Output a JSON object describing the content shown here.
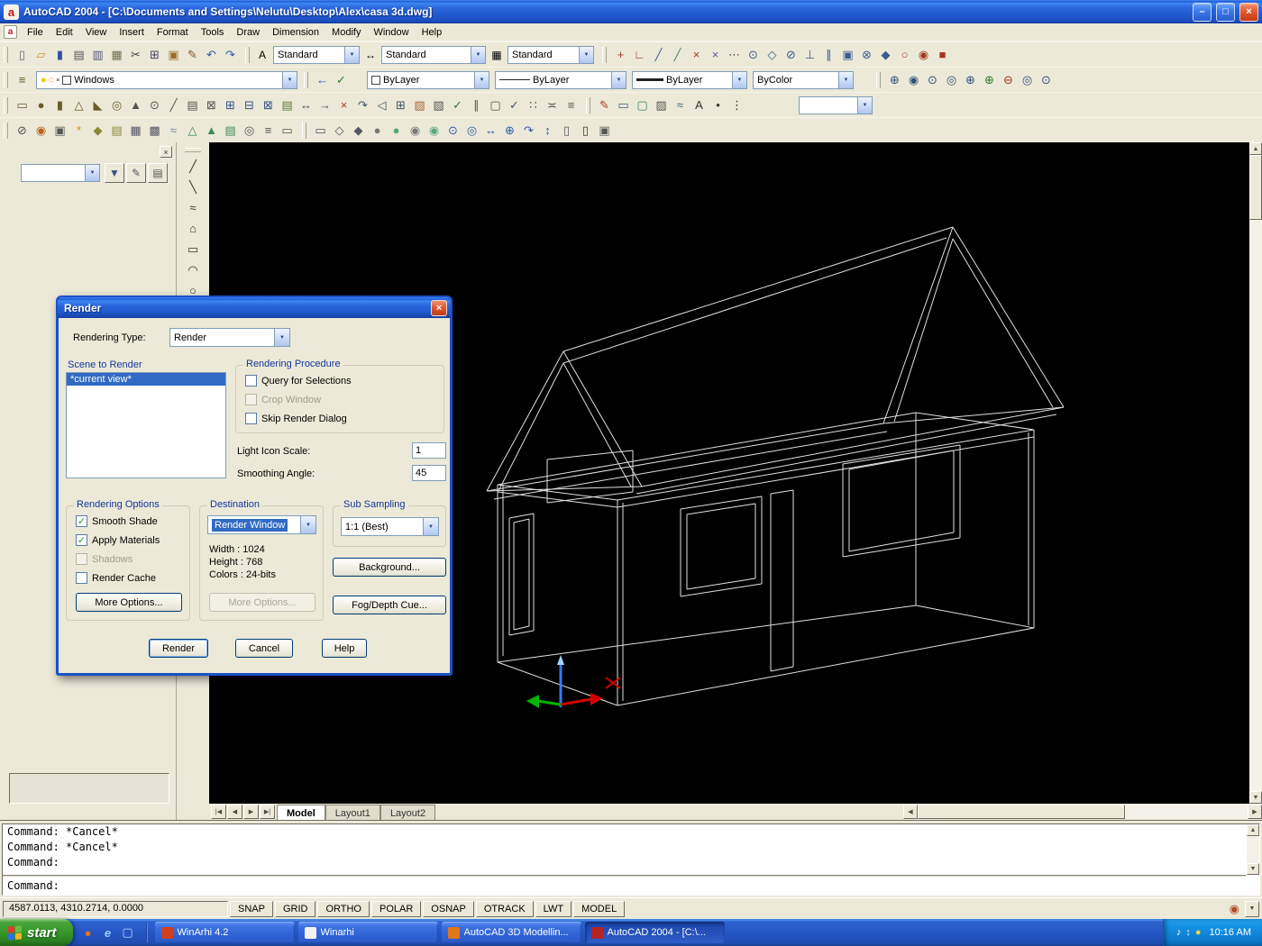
{
  "theme": {
    "face": "#ece9d8",
    "canvas": "#000000",
    "selection": "#316ac5",
    "caption": "#15359c",
    "wire": "#e0e0e0",
    "tray": "#1591e2",
    "start": "#379a2b",
    "task-a": "#5f93f2",
    "task-b": "#2c5ac4"
  },
  "glyphs": {
    "check": "✓",
    "up": "▲",
    "down": "▼",
    "left": "◀",
    "right": "▶",
    "min": "–",
    "restore": "□",
    "close": "×",
    "combo": "▼",
    "a": "a"
  },
  "titlebar": {
    "title": "AutoCAD 2004 - [C:\\Documents and Settings\\Nelutu\\Desktop\\Alex\\casa 3d.dwg]"
  },
  "menu": {
    "items": [
      {
        "n": "menu-file",
        "label": "File"
      },
      {
        "n": "menu-edit",
        "label": "Edit"
      },
      {
        "n": "menu-view",
        "label": "View"
      },
      {
        "n": "menu-insert",
        "label": "Insert"
      },
      {
        "n": "menu-format",
        "label": "Format"
      },
      {
        "n": "menu-tools",
        "label": "Tools"
      },
      {
        "n": "menu-draw",
        "label": "Draw"
      },
      {
        "n": "menu-dimension",
        "label": "Dimension"
      },
      {
        "n": "menu-modify",
        "label": "Modify"
      },
      {
        "n": "menu-window",
        "label": "Window"
      },
      {
        "n": "menu-help",
        "label": "Help"
      }
    ]
  },
  "row1": {
    "left_icons": [
      {
        "n": "new-file-icon",
        "g": "▯",
        "s": "color:#667"
      },
      {
        "n": "open-file-icon",
        "g": "▱",
        "s": "color:#c9972b"
      },
      {
        "n": "save-icon",
        "g": "▮",
        "s": "color:#34519e"
      },
      {
        "n": "plot-icon",
        "g": "▤",
        "s": "color:#555"
      },
      {
        "n": "plot-preview-icon",
        "g": "▥",
        "s": "color:#557"
      },
      {
        "n": "publish-icon",
        "g": "▦",
        "s": "color:#746c4f"
      },
      {
        "n": "cut-icon",
        "g": "✂",
        "s": "color:#444"
      },
      {
        "n": "copy-icon",
        "g": "⊞",
        "s": "color:#446"
      },
      {
        "n": "paste-icon",
        "g": "▣",
        "s": "color:#96702d"
      },
      {
        "n": "match-properties-icon",
        "g": "✎",
        "s": "color:#7c5220"
      },
      {
        "n": "undo-icon",
        "g": "↶",
        "s": "color:#2f58b0"
      },
      {
        "n": "redo-icon",
        "g": "↷",
        "s": "color:#2f58b0"
      }
    ],
    "style_icons": [
      {
        "g": "A",
        "s": "color:#334a80"
      },
      {
        "g": "↔",
        "s": "color:#334a80"
      },
      {
        "g": "▦",
        "s": "color:#334a80"
      }
    ],
    "text_style": "Standard",
    "dim_style": "Standard",
    "table_style": "Standard",
    "right_icons": [
      {
        "n": "temporary-track-point-icon",
        "g": "+",
        "s": "color:#a33c1f"
      },
      {
        "n": "snap-from-icon",
        "g": "∟",
        "s": "color:#a33c1f"
      },
      {
        "n": "snap-to-endpoint-icon",
        "g": "╱",
        "s": "color:#3b5d8c"
      },
      {
        "n": "snap-to-midpoint-icon",
        "g": "╱",
        "s": "color:#3b8c5d"
      },
      {
        "n": "snap-to-intersection-icon",
        "g": "×",
        "s": "color:#a33c1f"
      },
      {
        "n": "snap-to-apparent-intersection-icon",
        "g": "×",
        "s": "color:#6c4fa0"
      },
      {
        "n": "snap-to-extension-icon",
        "g": "⋯",
        "s": "color:#555"
      },
      {
        "n": "snap-to-center-icon",
        "g": "⊙",
        "s": "color:#3b5d8c"
      },
      {
        "n": "snap-to-quadrant-icon",
        "g": "◇",
        "s": "color:#3b5d8c"
      },
      {
        "n": "snap-to-tangent-icon",
        "g": "⊘",
        "s": "color:#3b5d8c"
      },
      {
        "n": "snap-to-perpendicular-icon",
        "g": "⊥",
        "s": "color:#3b5d8c"
      },
      {
        "n": "snap-to-parallel-icon",
        "g": "∥",
        "s": "color:#3b5d8c"
      },
      {
        "n": "snap-to-insert-icon",
        "g": "▣",
        "s": "color:#3b5d8c"
      },
      {
        "n": "snap-to-node-icon",
        "g": "⊗",
        "s": "color:#3b5d8c"
      },
      {
        "n": "snap-to-nearest-icon",
        "g": "◆",
        "s": "color:#3b5d8c"
      },
      {
        "n": "snap-to-none-icon",
        "g": "○",
        "s": "color:#a33c1f"
      },
      {
        "n": "osnap-settings-icon",
        "g": "◉",
        "s": "color:#a33c1f"
      },
      {
        "n": "dynamic-ucs-icon",
        "g": "■",
        "s": "color:#b03020"
      }
    ]
  },
  "row2": {
    "left_icons": [
      {
        "n": "layer-properties-manager-icon",
        "g": "≡",
        "s": "color:#6b5b2a"
      }
    ],
    "layer_state_icons": [
      {
        "n": "layer-on-icon",
        "g": "●",
        "s": "color:#f2c50a"
      },
      {
        "n": "layer-freeze-icon",
        "g": "○",
        "s": "color:#e8a020"
      },
      {
        "n": "layer-lock-icon",
        "g": "▪",
        "s": "color:#8a8a7a"
      }
    ],
    "layer_value": "Windows",
    "mid_icons": [
      {
        "n": "layer-previous-icon",
        "g": "←",
        "s": "color:#2f58b0"
      },
      {
        "n": "make-objects-layer-current-icon",
        "g": "✓",
        "s": "color:#2f7a2f"
      }
    ],
    "color_value": "ByLayer",
    "linetype_value": "ByLayer",
    "lineweight_value": "ByLayer",
    "plotstyle_value": "ByColor",
    "zoom_icons": [
      {
        "n": "zoom-window-icon",
        "g": "⊕",
        "s": "color:#33507a"
      },
      {
        "n": "zoom-dynamic-icon",
        "g": "◉",
        "s": "color:#33507a"
      },
      {
        "n": "zoom-scale-icon",
        "g": "⊙",
        "s": "color:#33507a"
      },
      {
        "n": "zoom-center-icon",
        "g": "◎",
        "s": "color:#33507a"
      },
      {
        "n": "zoom-object-icon",
        "g": "⊕",
        "s": "color:#33507a"
      },
      {
        "n": "zoom-in-icon",
        "g": "⊕",
        "s": "color:#2f7a2f"
      },
      {
        "n": "zoom-out-icon",
        "g": "⊖",
        "s": "color:#a33c1f"
      },
      {
        "n": "zoom-all-icon",
        "g": "◎",
        "s": "color:#33507a"
      },
      {
        "n": "zoom-extents-icon",
        "g": "⊙",
        "s": "color:#33507a"
      }
    ]
  },
  "row3": {
    "icons": [
      {
        "n": "box-icon",
        "g": "▭",
        "s": "color:#6b5b2a"
      },
      {
        "n": "sphere-icon",
        "g": "●",
        "s": "color:#6b5b2a"
      },
      {
        "n": "cylinder-icon",
        "g": "▮",
        "s": "color:#6b5b2a"
      },
      {
        "n": "cone-icon",
        "g": "△",
        "s": "color:#6b5b2a"
      },
      {
        "n": "wedge-icon",
        "g": "◣",
        "s": "color:#6b5b2a"
      },
      {
        "n": "torus-icon",
        "g": "◎",
        "s": "color:#6b5b2a"
      },
      {
        "n": "extrude-icon",
        "g": "▲",
        "s": "color:#555"
      },
      {
        "n": "revolve-icon",
        "g": "⊙",
        "s": "color:#555"
      },
      {
        "n": "slice-icon",
        "g": "╱",
        "s": "color:#555"
      },
      {
        "n": "section-icon",
        "g": "▤",
        "s": "color:#555"
      },
      {
        "n": "interference-icon",
        "g": "⊠",
        "s": "color:#555"
      },
      {
        "n": "union-icon",
        "g": "⊞",
        "s": "color:#36508a"
      },
      {
        "n": "subtract-icon",
        "g": "⊟",
        "s": "color:#36508a"
      },
      {
        "n": "intersect-icon",
        "g": "⊠",
        "s": "color:#36508a"
      },
      {
        "n": "extrude-faces-icon",
        "g": "▤",
        "s": "color:#5a7a34"
      },
      {
        "n": "move-faces-icon",
        "g": "↔",
        "s": "color:#44566a"
      },
      {
        "n": "offset-faces-icon",
        "g": "→",
        "s": "color:#44566a"
      },
      {
        "n": "delete-faces-icon",
        "g": "×",
        "s": "color:#a33c1f"
      },
      {
        "n": "rotate-faces-icon",
        "g": "↷",
        "s": "color:#44566a"
      },
      {
        "n": "taper-faces-icon",
        "g": "◁",
        "s": "color:#44566a"
      },
      {
        "n": "copy-faces-icon",
        "g": "⊞",
        "s": "color:#44566a"
      },
      {
        "n": "color-faces-icon",
        "g": "▨",
        "s": "color:#a3642f"
      },
      {
        "n": "imprint-icon",
        "g": "▧",
        "s": "color:#555"
      },
      {
        "n": "clean-icon",
        "g": "✓",
        "s": "color:#2f7a2f"
      },
      {
        "n": "separate-icon",
        "g": "∥",
        "s": "color:#555"
      },
      {
        "n": "shell-icon",
        "g": "▢",
        "s": "color:#555"
      },
      {
        "n": "check-icon",
        "g": "✓",
        "s": "color:#44566a"
      },
      {
        "n": "3d-array-icon",
        "g": "∷",
        "s": "color:#555"
      },
      {
        "n": "mirror-3d-icon",
        "g": "≍",
        "s": "color:#555"
      },
      {
        "n": "3d-align-icon",
        "g": "≡",
        "s": "color:#555"
      }
    ],
    "icons2": [
      {
        "n": "sketch-icon",
        "g": "✎",
        "s": "color:#a33c1f"
      },
      {
        "n": "region-icon",
        "g": "▭",
        "s": "color:#3b5d8c"
      },
      {
        "n": "boundary-icon",
        "g": "▢",
        "s": "color:#3b8c5d"
      },
      {
        "n": "wipeout-icon",
        "g": "▨",
        "s": "color:#555"
      },
      {
        "n": "revision-cloud-icon",
        "g": "≈",
        "s": "color:#3b5d8c"
      },
      {
        "n": "text-icon",
        "g": "A",
        "s": "color:#333"
      },
      {
        "n": "point-icon",
        "g": "•",
        "s": "color:#333"
      },
      {
        "n": "divide-icon",
        "g": "⋮",
        "s": "color:#333"
      }
    ],
    "view_combo_value": ""
  },
  "row4": {
    "icons": [
      {
        "n": "hide-icon",
        "g": "⊘",
        "s": "color:#555"
      },
      {
        "n": "render-icon",
        "g": "◉",
        "s": "color:#b5651d"
      },
      {
        "n": "scenes-icon",
        "g": "▣",
        "s": "color:#555"
      },
      {
        "n": "lights-icon",
        "g": "*",
        "s": "color:#d09010"
      },
      {
        "n": "materials-icon",
        "g": "◆",
        "s": "color:#8a8a34"
      },
      {
        "n": "materials-library-icon",
        "g": "▤",
        "s": "color:#8a8a34"
      },
      {
        "n": "mapping-icon",
        "g": "▦",
        "s": "color:#556"
      },
      {
        "n": "background-icon",
        "g": "▩",
        "s": "color:#556"
      },
      {
        "n": "fog-icon",
        "g": "≈",
        "s": "color:#7a89a8"
      },
      {
        "n": "landscape-new-icon",
        "g": "△",
        "s": "color:#3b8c5d"
      },
      {
        "n": "landscape-edit-icon",
        "g": "▲",
        "s": "color:#3b8c5d"
      },
      {
        "n": "landscape-library-icon",
        "g": "▤",
        "s": "color:#3b8c5d"
      },
      {
        "n": "render-preferences-icon",
        "g": "◎",
        "s": "color:#555"
      },
      {
        "n": "statistics-icon",
        "g": "≡",
        "s": "color:#555"
      },
      {
        "n": "render-window-icon",
        "g": "▭",
        "s": "color:#555"
      }
    ],
    "icons2": [
      {
        "n": "2d-wireframe-icon",
        "g": "▭",
        "s": "color:#556"
      },
      {
        "n": "3d-wireframe-icon",
        "g": "◇",
        "s": "color:#556"
      },
      {
        "n": "hidden-mode-icon",
        "g": "◆",
        "s": "color:#556"
      },
      {
        "n": "flat-shaded-icon",
        "g": "●",
        "s": "color:#777"
      },
      {
        "n": "gouraud-shaded-icon",
        "g": "●",
        "s": "color:#55a878"
      },
      {
        "n": "flat-shaded-edges-icon",
        "g": "◉",
        "s": "color:#777"
      },
      {
        "n": "gouraud-shaded-edges-icon",
        "g": "◉",
        "s": "color:#55a878"
      },
      {
        "n": "3d-orbit-icon",
        "g": "⊙",
        "s": "color:#2f58b0"
      },
      {
        "n": "3d-continuous-orbit-icon",
        "g": "◎",
        "s": "color:#2f58b0"
      },
      {
        "n": "3d-pan-icon",
        "g": "↔",
        "s": "color:#2f58b0"
      },
      {
        "n": "3d-zoom-icon",
        "g": "⊕",
        "s": "color:#2f58b0"
      },
      {
        "n": "3d-swivel-icon",
        "g": "↷",
        "s": "color:#2f58b0"
      },
      {
        "n": "3d-adjust-distance-icon",
        "g": "↕",
        "s": "color:#2f58b0"
      },
      {
        "n": "front-clip-icon",
        "g": "▯",
        "s": "color:#555"
      },
      {
        "n": "back-clip-icon",
        "g": "▯",
        "s": "color:#333"
      },
      {
        "n": "camera-icon",
        "g": "▣",
        "s": "color:#555"
      }
    ]
  },
  "vtoolbar": {
    "icons": [
      {
        "n": "line-icon",
        "g": "╱",
        "s": "color:#333"
      },
      {
        "n": "construction-line-icon",
        "g": "╲",
        "s": "color:#333"
      },
      {
        "n": "revision-cloud-icon",
        "g": "≈",
        "s": "color:#333"
      },
      {
        "n": "polygon-icon",
        "g": "⌂",
        "s": "color:#333"
      },
      {
        "n": "rectangle-icon",
        "g": "▭",
        "s": "color:#333"
      },
      {
        "n": "arc-icon",
        "g": "◠",
        "s": "color:#333"
      },
      {
        "n": "circle-icon",
        "g": "○",
        "s": "color:#333"
      }
    ]
  },
  "left_panel": {
    "buttons": [
      {
        "n": "filter-icon",
        "g": "▼",
        "s": "color:#36508a"
      },
      {
        "n": "edit-icon",
        "g": "✎",
        "s": "color:#555"
      },
      {
        "n": "list-icon",
        "g": "▤",
        "s": "color:#555"
      }
    ]
  },
  "tabs": {
    "nav": [
      {
        "n": "first-tab-button",
        "g": "|◀"
      },
      {
        "n": "prev-tab-button",
        "g": "◀"
      },
      {
        "n": "next-tab-button",
        "g": "▶"
      },
      {
        "n": "last-tab-button",
        "g": "▶|"
      }
    ],
    "model": "Model",
    "layout1": "Layout1",
    "layout2": "Layout2"
  },
  "command": {
    "history": [
      "Command: *Cancel*",
      "Command: *Cancel*",
      "Command:"
    ],
    "prompt": "Command:"
  },
  "statusbar": {
    "coords": "4587.0113, 4310.2714, 0.0000",
    "toggles": [
      {
        "n": "snap-toggle",
        "label": "SNAP"
      },
      {
        "n": "grid-toggle",
        "label": "GRID"
      },
      {
        "n": "ortho-toggle",
        "label": "ORTHO"
      },
      {
        "n": "polar-toggle",
        "label": "POLAR"
      },
      {
        "n": "osnap-toggle",
        "label": "OSNAP"
      },
      {
        "n": "otrack-toggle",
        "label": "OTRACK"
      },
      {
        "n": "lwt-toggle",
        "label": "LWT"
      },
      {
        "n": "model-toggle",
        "label": "MODEL"
      }
    ]
  },
  "taskbar": {
    "start_label": "start",
    "quick_launch": [
      {
        "n": "firefox-icon",
        "g": "●",
        "s": "color:#e8701a"
      },
      {
        "n": "internet-explorer-icon",
        "g": "e",
        "s": "color:#9fd0ff;font-style:italic"
      },
      {
        "n": "show-desktop-icon",
        "g": "▢",
        "s": "color:#bcd6f8"
      }
    ],
    "tasks": [
      {
        "n": "task-winarhi-42",
        "label": "WinArhi 4.2",
        "cls": "task",
        "ic": "background:#d04020"
      },
      {
        "n": "task-winarhi",
        "label": "Winarhi",
        "cls": "task",
        "ic": "background:#f2f2f2;color:#555"
      },
      {
        "n": "task-autocad-3d-modelling",
        "label": "AutoCAD 3D Modellin...",
        "cls": "task",
        "ic": "background:#e07818"
      },
      {
        "n": "task-autocad-2004",
        "label": "AutoCAD 2004 - [C:\\...",
        "cls": "task active",
        "ic": "background:#b32424"
      }
    ],
    "tray_icons": [
      {
        "n": "volume-icon",
        "g": "♪",
        "s": "color:#ffffff"
      },
      {
        "n": "network-icon",
        "g": "↕",
        "s": "color:#cfe6ff"
      },
      {
        "n": "updates-icon",
        "g": "●",
        "s": "color:#ffd24a"
      }
    ],
    "clock": "10:16 AM"
  },
  "dialog": {
    "title": "Render",
    "rendering_type_label": "Rendering Type:",
    "rendering_type_value": "Render",
    "scene_label": "Scene to Render",
    "scene_items": [
      "*current view*"
    ],
    "procedure": {
      "title": "Rendering Procedure",
      "query": "Query for Selections",
      "crop": "Crop Window",
      "skip": "Skip Render Dialog"
    },
    "light_icon_scale_label": "Light Icon Scale:",
    "light_icon_scale_value": "1",
    "smoothing_angle_label": "Smoothing Angle:",
    "smoothing_angle_value": "45",
    "options": {
      "title": "Rendering Options",
      "smooth": "Smooth Shade",
      "materials": "Apply Materials",
      "shadows": "Shadows",
      "cache": "Render Cache",
      "more": "More Options..."
    },
    "destination": {
      "title": "Destination",
      "value": "Render Window",
      "width": "Width : 1024",
      "height": "Height : 768",
      "colors": "Colors : 24-bits",
      "more": "More Options..."
    },
    "subsampling": {
      "title": "Sub Sampling",
      "value": "1:1 (Best)"
    },
    "background_btn": "Background...",
    "fog_btn": "Fog/Depth Cue...",
    "render_btn": "Render",
    "cancel_btn": "Cancel",
    "help_btn": "Help"
  }
}
